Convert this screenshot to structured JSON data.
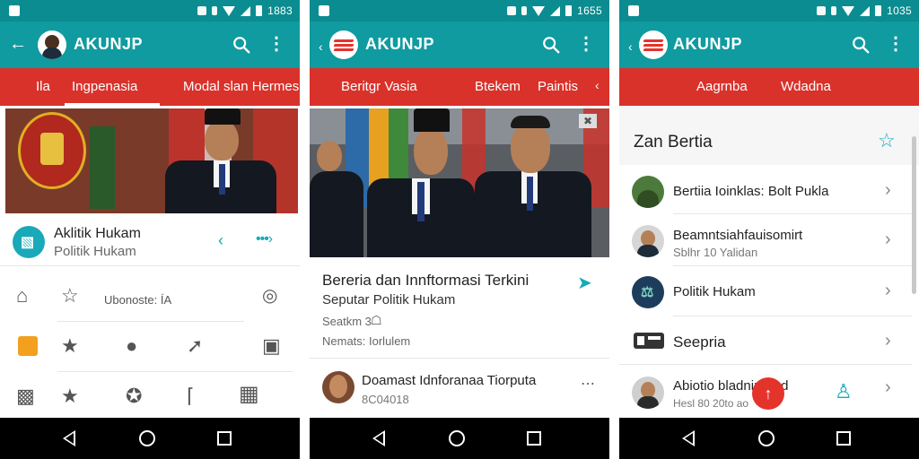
{
  "status_bar": {
    "times": [
      "1883",
      "1655",
      "1035"
    ]
  },
  "app": {
    "title": "AKUNJP"
  },
  "colors": {
    "teal": "#0f9ba0",
    "status_teal": "#0a8c90",
    "red_tab": "#d9322b",
    "accent_cyan": "#19a9b8"
  },
  "screen1": {
    "tabs": [
      "Ila",
      "Ingpenasia",
      "Modal slan Hermes"
    ],
    "profile": {
      "name": "Aklitik Hukam",
      "category": "Politik Hukam"
    },
    "grid_label": "Ubonoste: ÍA",
    "icons": [
      "home-icon",
      "star-flip-icon",
      "compass-icon",
      "blogger-icon",
      "star-icon",
      "speech-bubble-icon",
      "pin-icon",
      "download-box-icon",
      "alarm-icon",
      "star-icon",
      "puzzle-icon",
      "hanger-icon",
      "chart-icon"
    ]
  },
  "screen2": {
    "tabs": [
      "Beritgr Vasia",
      "Btekem",
      "Paintis"
    ],
    "article": {
      "title": "Bereria dan Innftormasi Terkini",
      "subtitle": "Seputar Politik Hukam",
      "meta1": "Seatkm 3",
      "meta2": "Nemats: Iorlulem"
    },
    "next_item": {
      "title": "Doamast Idnforanaa Tiorputa",
      "date": "8C04018"
    }
  },
  "screen3": {
    "tabs": [
      "Aagrnba",
      "Wdadna"
    ],
    "heading": "Zan Bertia",
    "items": [
      {
        "title": "Bertiia Ioinklas: Bolt Pukla",
        "sub": ""
      },
      {
        "title": "Beamntsiahfauisomirt",
        "sub": "Sblhr 10 Yalidan"
      },
      {
        "title": "Politik Hukam",
        "sub": ""
      },
      {
        "title": "Seepria",
        "sub": ""
      },
      {
        "title": "Abiotio bladnirt and",
        "sub": "Hesl 80 20to ao"
      }
    ]
  }
}
